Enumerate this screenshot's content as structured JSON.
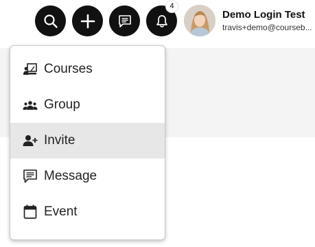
{
  "header": {
    "actions": [
      {
        "icon": "search-icon",
        "label": "Search"
      },
      {
        "icon": "plus-icon",
        "label": "Create"
      },
      {
        "icon": "message-icon",
        "label": "Messages"
      },
      {
        "icon": "bell-icon",
        "label": "Notifications"
      }
    ],
    "notification_count": "4",
    "user": {
      "name": "Demo Login Test",
      "email": "travis+demo@courseb..."
    }
  },
  "create_menu": {
    "items": [
      {
        "label": "Courses",
        "icon": "courses-icon",
        "active": false
      },
      {
        "label": "Group",
        "icon": "group-icon",
        "active": false
      },
      {
        "label": "Invite",
        "icon": "add-user-icon",
        "active": true
      },
      {
        "label": "Message",
        "icon": "message-icon",
        "active": false
      },
      {
        "label": "Event",
        "icon": "calendar-icon",
        "active": false
      }
    ]
  },
  "colors": {
    "header_button": "#111111",
    "menu_hover": "#e7e7e7",
    "content_band": "#f4f4f4"
  }
}
